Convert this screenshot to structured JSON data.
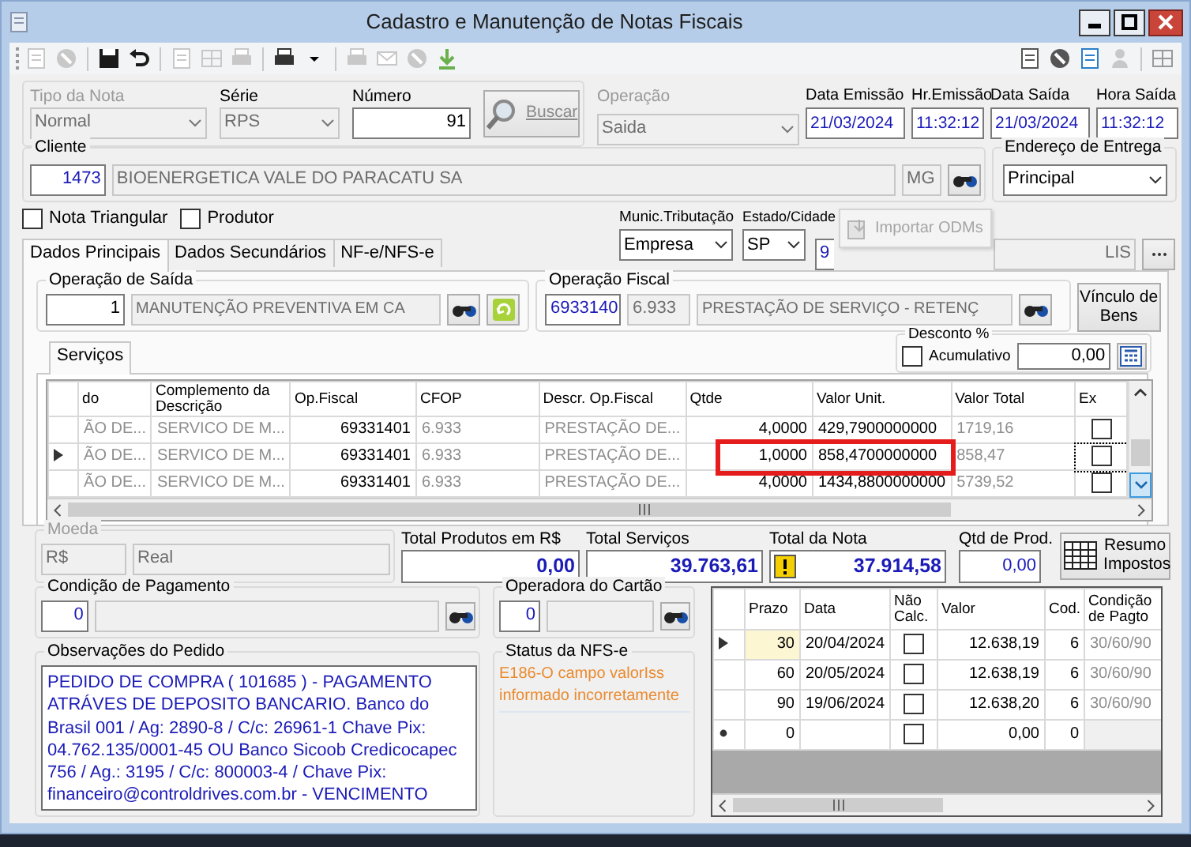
{
  "window": {
    "title": "Cadastro e Manutenção de Notas Fiscais"
  },
  "header": {
    "tipo_nota": {
      "label": "Tipo da Nota",
      "value": "Normal",
      "disabled": true
    },
    "serie": {
      "label": "Série",
      "value": "RPS"
    },
    "numero": {
      "label": "Número",
      "value": "91"
    },
    "buscar": {
      "label": "Buscar",
      "disabled": true
    },
    "operacao": {
      "label": "Operação",
      "value": "Saida",
      "disabled": true
    },
    "data_emissao": {
      "label": "Data Emissão",
      "value": "21/03/2024"
    },
    "hr_emissao": {
      "label": "Hr.Emissão",
      "value": "11:32:12"
    },
    "data_saida": {
      "label": "Data Saída",
      "value": "21/03/2024"
    },
    "hora_saida": {
      "label": "Hora Saída",
      "value": "11:32:12"
    }
  },
  "cliente": {
    "label": "Cliente",
    "code": "1473",
    "name": "BIOENERGETICA VALE DO PARACATU SA",
    "uf": "MG"
  },
  "endereco_entrega": {
    "label": "Endereço de Entrega",
    "value": "Principal"
  },
  "checkboxes": [
    {
      "label": "Nota Triangular",
      "checked": false
    },
    {
      "label": "Produtor",
      "checked": false
    }
  ],
  "municipio": {
    "tributacao_label": "Munic.Tributação",
    "tributacao": "Empresa",
    "estado_label": "Estado/Cidade",
    "estado": "SP",
    "cidade_code": "9",
    "cidade": "LIS"
  },
  "importar_odms": {
    "label": "Importar ODMs",
    "disabled": true
  },
  "tabs": [
    {
      "label": "Dados Principais",
      "selected": true
    },
    {
      "label": "Dados Secundários",
      "selected": false
    },
    {
      "label": "NF-e/NFS-e",
      "selected": false
    }
  ],
  "operacao_saida": {
    "label": "Operação de Saída",
    "code": "1",
    "description": "MANUTENÇÃO PREVENTIVA EM CA"
  },
  "operacao_fiscal": {
    "label": "Operação Fiscal",
    "code": "6933140",
    "cfop": "6.933",
    "description": "PRESTAÇÃO DE SERVIÇO - RETENÇ"
  },
  "vinculo_bens": {
    "label": "Vínculo de Bens"
  },
  "servicos_tab": {
    "label": "Serviços",
    "selected": true
  },
  "desconto": {
    "label": "Desconto %",
    "acumulativo_label": "Acumulativo",
    "acumulativo": false,
    "value": "0,00"
  },
  "services_grid": {
    "columns": [
      "do",
      "Complemento da Descrição",
      "Op.Fiscal",
      "CFOP",
      "Descr. Op.Fiscal",
      "Qtde",
      "Valor Unit.",
      "Valor Total",
      "Ex"
    ],
    "rows": [
      {
        "col_1": "ÃO DE...",
        "complemento": "SERVICO DE M...",
        "op_fiscal": "69331401",
        "cfop": "6.933",
        "descr": "PRESTAÇÃO DE...",
        "qtde": "4,0000",
        "valor_unit": "429,7900000000",
        "valor_total": "1719,16",
        "ex": false,
        "selected": false,
        "highlighted": false
      },
      {
        "col_1": "ÃO DE...",
        "complemento": "SERVICO DE M...",
        "op_fiscal": "69331401",
        "cfop": "6.933",
        "descr": "PRESTAÇÃO DE...",
        "qtde": "1,0000",
        "valor_unit": "858,4700000000",
        "valor_total": "858,47",
        "ex": false,
        "selected": true,
        "highlighted": true
      },
      {
        "col_1": "ÃO DE...",
        "complemento": "SERVICO DE M...",
        "op_fiscal": "69331401",
        "cfop": "6.933",
        "descr": "PRESTAÇÃO DE...",
        "qtde": "4,0000",
        "valor_unit": "1434,8800000000",
        "valor_total": "5739,52",
        "ex": false,
        "selected": false,
        "highlighted": false
      }
    ]
  },
  "moeda": {
    "label": "Moeda",
    "code": "R$",
    "name": "Real"
  },
  "totals": {
    "total_produtos_label": "Total Produtos em R$",
    "total_produtos": "0,00",
    "total_servicos_label": "Total Serviços",
    "total_servicos": "39.763,61",
    "total_nota_label": "Total da Nota",
    "total_nota": "37.914,58",
    "warning": true,
    "qtd_prod_label": "Qtd de Prod.",
    "qtd_prod": "0,00"
  },
  "resumo_impostos": {
    "label": "Resumo Impostos"
  },
  "condicao_pagamento": {
    "label": "Condição de Pagamento",
    "code": "0"
  },
  "operadora_cartao": {
    "label": "Operadora do Cartão",
    "code": "0"
  },
  "observacoes": {
    "label": "Observações do Pedido",
    "lines": [
      "PEDIDO DE COMPRA ( 101685 ) - PAGAMENTO",
      "ATRÁVES DE DEPOSITO BANCARIO. Banco do",
      "Brasil 001 /  Ag: 2890-8 / C/c: 26961-1 Chave Pix:",
      "04.762.135/0001-45 OU Banco Sicoob Credicocapec",
      "756 / Ag.: 3195 /  C/c: 800003-4 / Chave Pix:",
      "financeiro@controldrives.com.br - VENCIMENTO"
    ]
  },
  "status_nfse": {
    "label": "Status da NFS-e",
    "lines": [
      "E186-O campo valorIss",
      "informado incorretamente"
    ]
  },
  "parcelas": {
    "columns": [
      "Prazo",
      "Data",
      "Não Calc.",
      "Valor",
      "Cod.",
      "Condição de Pagto"
    ],
    "rows": [
      {
        "kind": "row",
        "prazo": "30",
        "data": "20/04/2024",
        "nao_calc": false,
        "valor": "12.638,19",
        "cod": "6",
        "condicao": "30/60/90",
        "selected": true
      },
      {
        "kind": "row",
        "prazo": "60",
        "data": "20/05/2024",
        "nao_calc": false,
        "valor": "12.638,19",
        "cod": "6",
        "condicao": "30/60/90",
        "selected": false
      },
      {
        "kind": "row",
        "prazo": "90",
        "data": "19/06/2024",
        "nao_calc": false,
        "valor": "12.638,20",
        "cod": "6",
        "condicao": "30/60/90",
        "selected": false
      },
      {
        "kind": "new",
        "prazo": "0",
        "nao_calc": false,
        "valor": "0,00",
        "cod": "0",
        "selected": false
      }
    ]
  }
}
